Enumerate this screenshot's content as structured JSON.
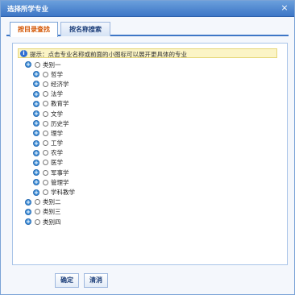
{
  "dialog": {
    "title": "选择所学专业",
    "close_symbol": "×"
  },
  "tabs": [
    {
      "label": "按目录查找",
      "active": true
    },
    {
      "label": "按名称搜索",
      "active": false
    }
  ],
  "hint": {
    "icon": "info-icon",
    "text": "提示：点击专业名称或前面的小图标可以展开更具体的专业"
  },
  "tree": {
    "expand_symbol": "+",
    "category1": {
      "label": "类别一",
      "children": [
        "哲学",
        "经济学",
        "法学",
        "教育学",
        "文学",
        "历史学",
        "理学",
        "工学",
        "农学",
        "医学",
        "军事学",
        "管理学",
        "学科教学"
      ]
    },
    "category2": {
      "label": "类别二"
    },
    "category3": {
      "label": "类别三"
    },
    "category4": {
      "label": "类别四"
    }
  },
  "buttons": {
    "ok": "确定",
    "cancel": "清消"
  },
  "colors": {
    "title_bar": "#3d76c6",
    "active_tab_text": "#d35400",
    "expander": "#3f8fd8",
    "hint_bg": "#fbf4c6"
  }
}
